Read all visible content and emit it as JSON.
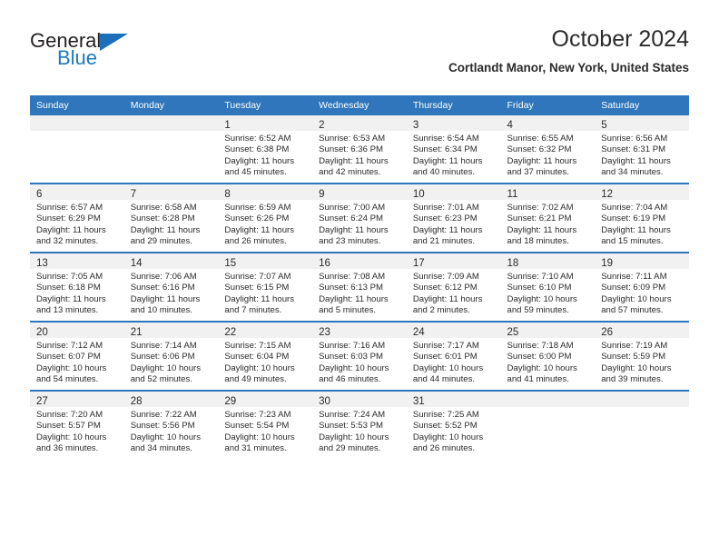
{
  "brand": {
    "name_top": "General",
    "name_bottom": "Blue",
    "triangle_color": "#1c6fba",
    "blue_text_color": "#1c79c0"
  },
  "header": {
    "title": "October 2024",
    "subtitle": "Cortlandt Manor, New York, United States"
  },
  "theme": {
    "header_blue": "#2f76bc",
    "day_band_gray": "#f1f1f1",
    "text": "#2b2b2b"
  },
  "weekday_headers": [
    "Sunday",
    "Monday",
    "Tuesday",
    "Wednesday",
    "Thursday",
    "Friday",
    "Saturday"
  ],
  "labels": {
    "sunrise_prefix": "Sunrise: ",
    "sunset_prefix": "Sunset: ",
    "daylight_prefix": "Daylight: "
  },
  "weeks": [
    [
      {
        "empty": true
      },
      {
        "empty": true
      },
      {
        "day": "1",
        "sunrise": "Sunrise: 6:52 AM",
        "sunset": "Sunset: 6:38 PM",
        "daylight1": "Daylight: 11 hours",
        "daylight2": "and 45 minutes."
      },
      {
        "day": "2",
        "sunrise": "Sunrise: 6:53 AM",
        "sunset": "Sunset: 6:36 PM",
        "daylight1": "Daylight: 11 hours",
        "daylight2": "and 42 minutes."
      },
      {
        "day": "3",
        "sunrise": "Sunrise: 6:54 AM",
        "sunset": "Sunset: 6:34 PM",
        "daylight1": "Daylight: 11 hours",
        "daylight2": "and 40 minutes."
      },
      {
        "day": "4",
        "sunrise": "Sunrise: 6:55 AM",
        "sunset": "Sunset: 6:32 PM",
        "daylight1": "Daylight: 11 hours",
        "daylight2": "and 37 minutes."
      },
      {
        "day": "5",
        "sunrise": "Sunrise: 6:56 AM",
        "sunset": "Sunset: 6:31 PM",
        "daylight1": "Daylight: 11 hours",
        "daylight2": "and 34 minutes."
      }
    ],
    [
      {
        "day": "6",
        "sunrise": "Sunrise: 6:57 AM",
        "sunset": "Sunset: 6:29 PM",
        "daylight1": "Daylight: 11 hours",
        "daylight2": "and 32 minutes."
      },
      {
        "day": "7",
        "sunrise": "Sunrise: 6:58 AM",
        "sunset": "Sunset: 6:28 PM",
        "daylight1": "Daylight: 11 hours",
        "daylight2": "and 29 minutes."
      },
      {
        "day": "8",
        "sunrise": "Sunrise: 6:59 AM",
        "sunset": "Sunset: 6:26 PM",
        "daylight1": "Daylight: 11 hours",
        "daylight2": "and 26 minutes."
      },
      {
        "day": "9",
        "sunrise": "Sunrise: 7:00 AM",
        "sunset": "Sunset: 6:24 PM",
        "daylight1": "Daylight: 11 hours",
        "daylight2": "and 23 minutes."
      },
      {
        "day": "10",
        "sunrise": "Sunrise: 7:01 AM",
        "sunset": "Sunset: 6:23 PM",
        "daylight1": "Daylight: 11 hours",
        "daylight2": "and 21 minutes."
      },
      {
        "day": "11",
        "sunrise": "Sunrise: 7:02 AM",
        "sunset": "Sunset: 6:21 PM",
        "daylight1": "Daylight: 11 hours",
        "daylight2": "and 18 minutes."
      },
      {
        "day": "12",
        "sunrise": "Sunrise: 7:04 AM",
        "sunset": "Sunset: 6:19 PM",
        "daylight1": "Daylight: 11 hours",
        "daylight2": "and 15 minutes."
      }
    ],
    [
      {
        "day": "13",
        "sunrise": "Sunrise: 7:05 AM",
        "sunset": "Sunset: 6:18 PM",
        "daylight1": "Daylight: 11 hours",
        "daylight2": "and 13 minutes."
      },
      {
        "day": "14",
        "sunrise": "Sunrise: 7:06 AM",
        "sunset": "Sunset: 6:16 PM",
        "daylight1": "Daylight: 11 hours",
        "daylight2": "and 10 minutes."
      },
      {
        "day": "15",
        "sunrise": "Sunrise: 7:07 AM",
        "sunset": "Sunset: 6:15 PM",
        "daylight1": "Daylight: 11 hours",
        "daylight2": "and 7 minutes."
      },
      {
        "day": "16",
        "sunrise": "Sunrise: 7:08 AM",
        "sunset": "Sunset: 6:13 PM",
        "daylight1": "Daylight: 11 hours",
        "daylight2": "and 5 minutes."
      },
      {
        "day": "17",
        "sunrise": "Sunrise: 7:09 AM",
        "sunset": "Sunset: 6:12 PM",
        "daylight1": "Daylight: 11 hours",
        "daylight2": "and 2 minutes."
      },
      {
        "day": "18",
        "sunrise": "Sunrise: 7:10 AM",
        "sunset": "Sunset: 6:10 PM",
        "daylight1": "Daylight: 10 hours",
        "daylight2": "and 59 minutes."
      },
      {
        "day": "19",
        "sunrise": "Sunrise: 7:11 AM",
        "sunset": "Sunset: 6:09 PM",
        "daylight1": "Daylight: 10 hours",
        "daylight2": "and 57 minutes."
      }
    ],
    [
      {
        "day": "20",
        "sunrise": "Sunrise: 7:12 AM",
        "sunset": "Sunset: 6:07 PM",
        "daylight1": "Daylight: 10 hours",
        "daylight2": "and 54 minutes."
      },
      {
        "day": "21",
        "sunrise": "Sunrise: 7:14 AM",
        "sunset": "Sunset: 6:06 PM",
        "daylight1": "Daylight: 10 hours",
        "daylight2": "and 52 minutes."
      },
      {
        "day": "22",
        "sunrise": "Sunrise: 7:15 AM",
        "sunset": "Sunset: 6:04 PM",
        "daylight1": "Daylight: 10 hours",
        "daylight2": "and 49 minutes."
      },
      {
        "day": "23",
        "sunrise": "Sunrise: 7:16 AM",
        "sunset": "Sunset: 6:03 PM",
        "daylight1": "Daylight: 10 hours",
        "daylight2": "and 46 minutes."
      },
      {
        "day": "24",
        "sunrise": "Sunrise: 7:17 AM",
        "sunset": "Sunset: 6:01 PM",
        "daylight1": "Daylight: 10 hours",
        "daylight2": "and 44 minutes."
      },
      {
        "day": "25",
        "sunrise": "Sunrise: 7:18 AM",
        "sunset": "Sunset: 6:00 PM",
        "daylight1": "Daylight: 10 hours",
        "daylight2": "and 41 minutes."
      },
      {
        "day": "26",
        "sunrise": "Sunrise: 7:19 AM",
        "sunset": "Sunset: 5:59 PM",
        "daylight1": "Daylight: 10 hours",
        "daylight2": "and 39 minutes."
      }
    ],
    [
      {
        "day": "27",
        "sunrise": "Sunrise: 7:20 AM",
        "sunset": "Sunset: 5:57 PM",
        "daylight1": "Daylight: 10 hours",
        "daylight2": "and 36 minutes."
      },
      {
        "day": "28",
        "sunrise": "Sunrise: 7:22 AM",
        "sunset": "Sunset: 5:56 PM",
        "daylight1": "Daylight: 10 hours",
        "daylight2": "and 34 minutes."
      },
      {
        "day": "29",
        "sunrise": "Sunrise: 7:23 AM",
        "sunset": "Sunset: 5:54 PM",
        "daylight1": "Daylight: 10 hours",
        "daylight2": "and 31 minutes."
      },
      {
        "day": "30",
        "sunrise": "Sunrise: 7:24 AM",
        "sunset": "Sunset: 5:53 PM",
        "daylight1": "Daylight: 10 hours",
        "daylight2": "and 29 minutes."
      },
      {
        "day": "31",
        "sunrise": "Sunrise: 7:25 AM",
        "sunset": "Sunset: 5:52 PM",
        "daylight1": "Daylight: 10 hours",
        "daylight2": "and 26 minutes."
      },
      {
        "empty": true
      },
      {
        "empty": true
      }
    ]
  ]
}
